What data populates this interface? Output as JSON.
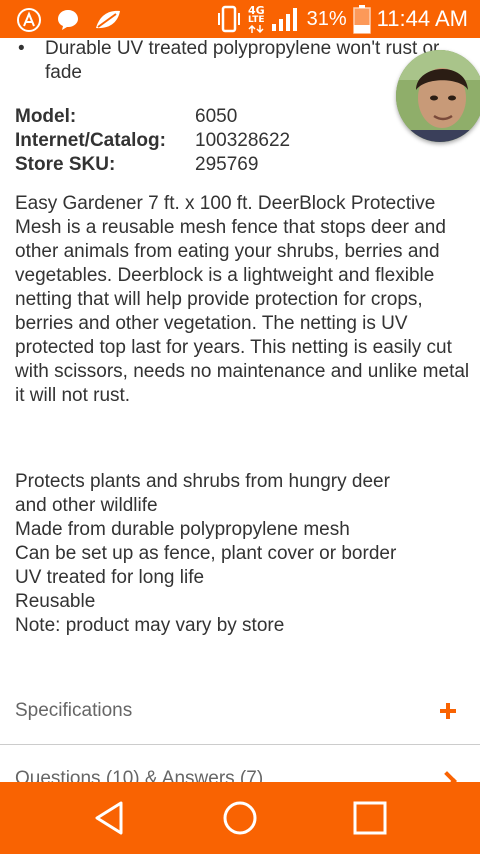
{
  "status_bar": {
    "battery_percent": "31%",
    "time": "11:44 AM",
    "network_type": "4G",
    "network_sub": "LTE",
    "icons": [
      "app-a-icon",
      "chat-icon",
      "leaf-icon",
      "vibrate-icon",
      "signal-icon",
      "battery-icon"
    ]
  },
  "product": {
    "bullet_partial": "Durable UV treated polypropylene won't rust or fade",
    "model_label": "Model:",
    "model_value": "6050",
    "internet_label": "Internet/Catalog:",
    "internet_value": "100328622",
    "sku_label": "Store SKU:",
    "sku_value": "295769",
    "description": "Easy Gardener 7 ft. x 100 ft. DeerBlock Protective Mesh is a reusable mesh fence that stops deer and other animals from eating your shrubs, berries and vegetables. Deerblock is a lightweight and flexible netting that will help provide protection for crops, berries and other vegetation. The netting is UV protected top last for years. This netting is easily cut with scissors, needs no maintenance and unlike metal it will not rust.",
    "features": [
      "Protects plants and shrubs from hungry deer",
      "and other wildlife",
      "Made from durable polypropylene mesh",
      "Can be set up as fence, plant cover or border",
      "UV treated for long life",
      "Reusable",
      "Note: product may vary by store"
    ]
  },
  "sections": {
    "specifications_label": "Specifications",
    "qa_label": "Questions (10) & Answers (7)"
  },
  "colors": {
    "accent": "#f96302",
    "text": "#333333",
    "muted": "#666666"
  },
  "nav": {
    "back": "back-icon",
    "home": "home-icon",
    "recents": "recents-icon"
  }
}
